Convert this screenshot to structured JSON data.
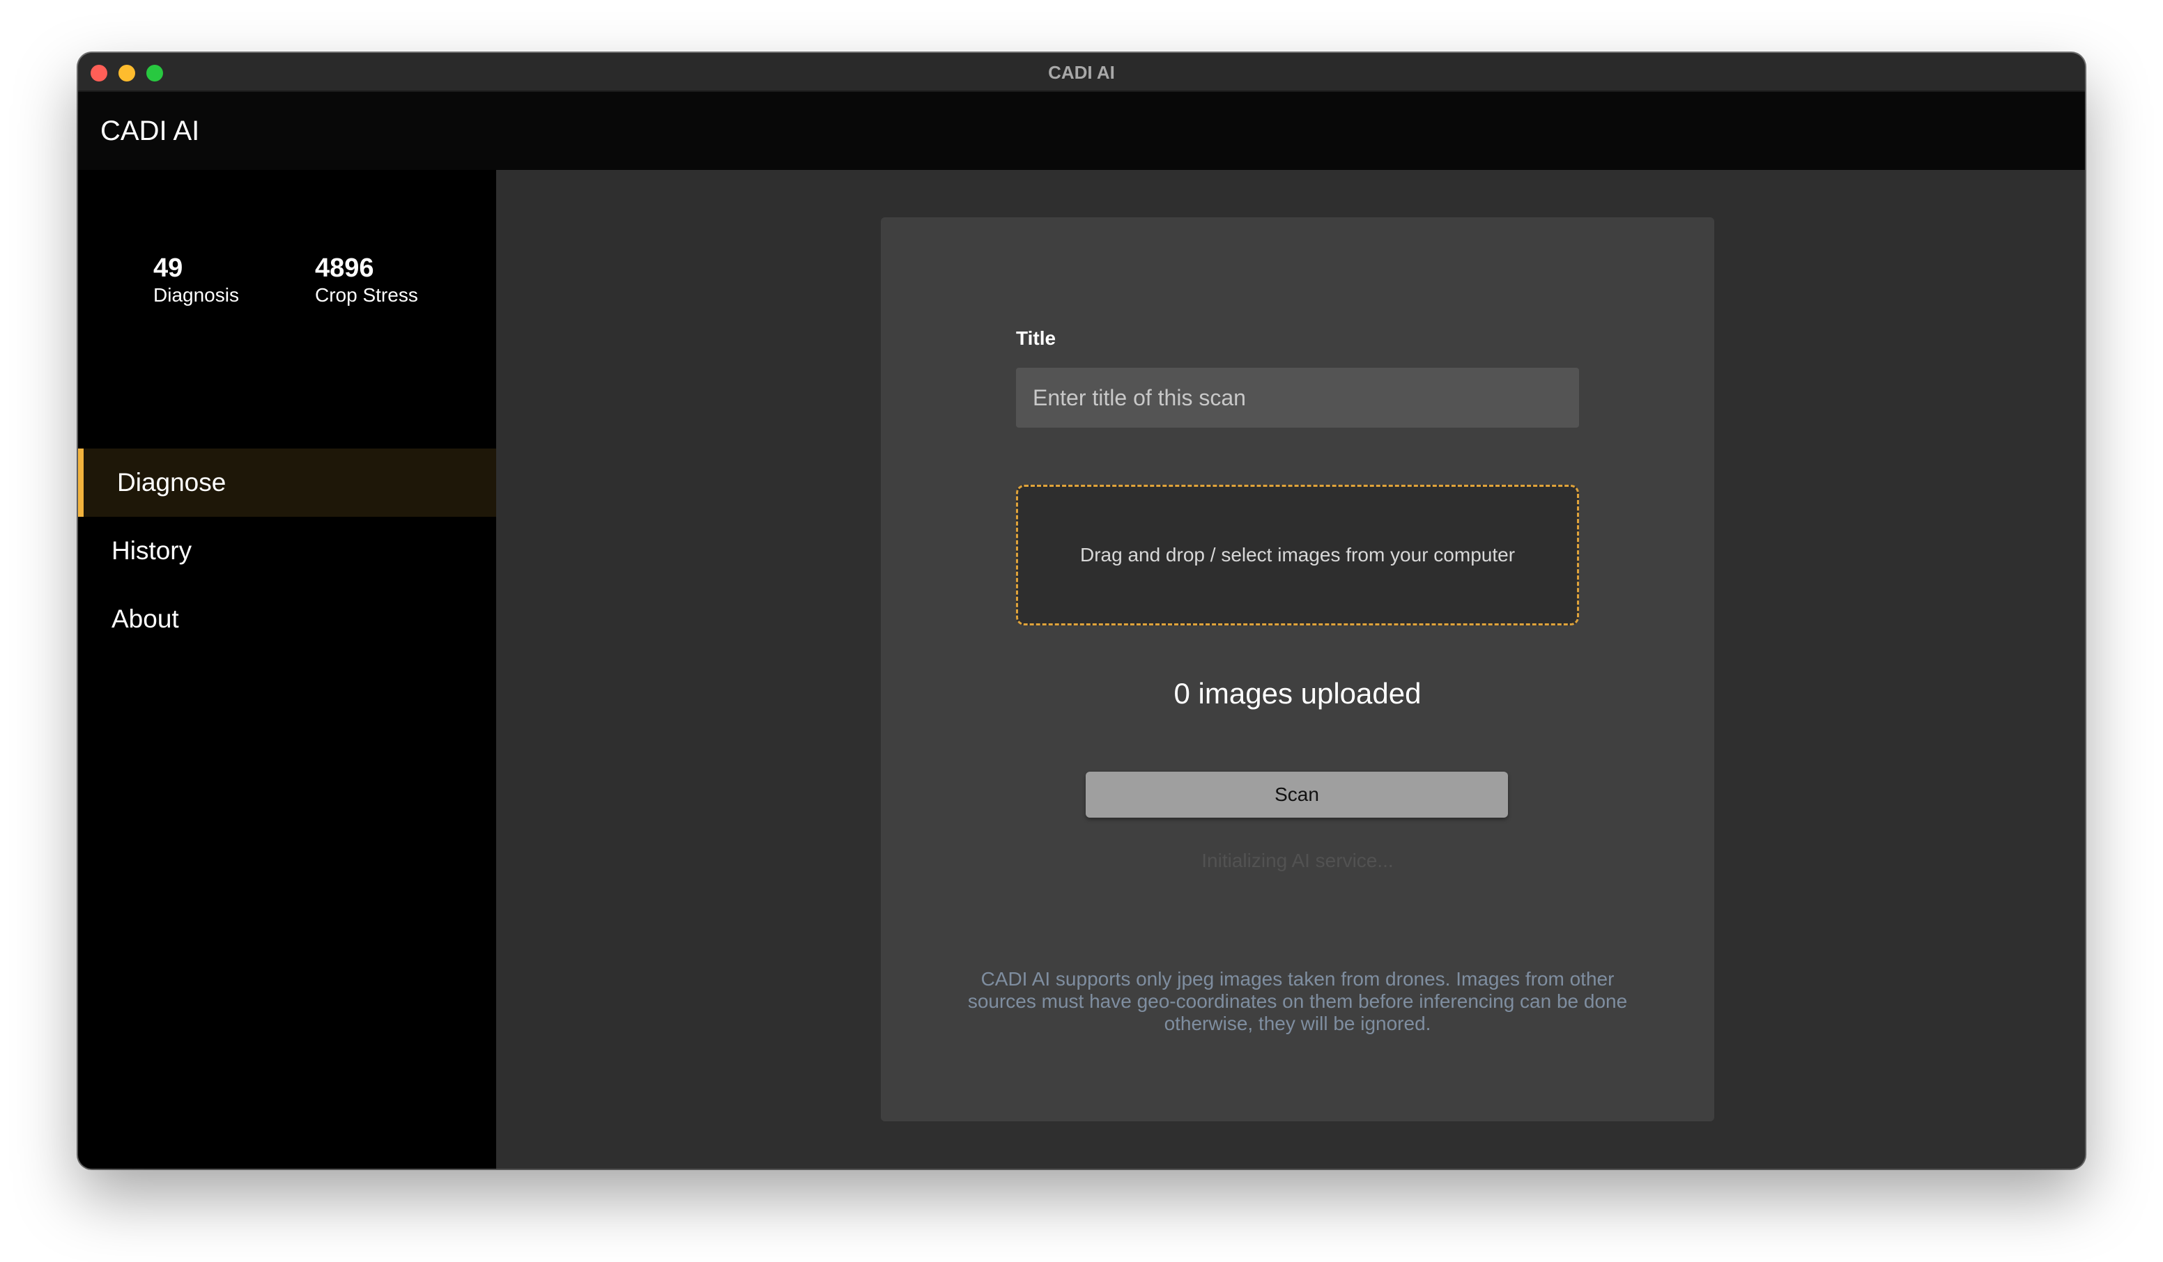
{
  "window": {
    "title": "CADI AI"
  },
  "appbar": {
    "title": "CADI AI"
  },
  "stats": [
    {
      "value": "49",
      "label": "Diagnosis"
    },
    {
      "value": "4896",
      "label": "Crop Stress"
    }
  ],
  "nav": {
    "items": [
      {
        "label": "Diagnose",
        "active": true
      },
      {
        "label": "History",
        "active": false
      },
      {
        "label": "About",
        "active": false
      }
    ]
  },
  "form": {
    "title_label": "Title",
    "title_value": "",
    "title_placeholder": "Enter title of this scan",
    "dropzone_text": "Drag and drop / select images from your computer",
    "upload_count": "0 images uploaded",
    "scan_label": "Scan",
    "status": "Initializing AI service...",
    "note": "CADI AI supports only jpeg images taken from drones. Images from other sources must have geo-coordinates on them before inferencing can be done otherwise, they will be ignored."
  },
  "colors": {
    "accent": "#f2b33d",
    "note_text": "#7f8ea0"
  }
}
